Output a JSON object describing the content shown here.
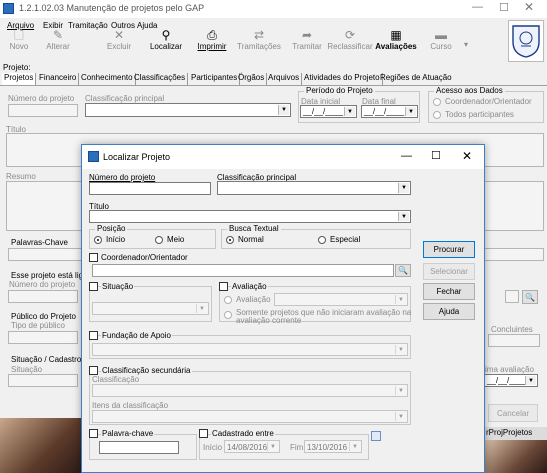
{
  "window": {
    "title": "1.2.1.02.03 Manutenção de projetos pelo GAP",
    "seal_text": "Universidade Federal de Viçosa"
  },
  "menu": [
    "Arquivo",
    "Exibir",
    "Tramitação",
    "Outros",
    "Ajuda"
  ],
  "toolbar": [
    {
      "label": "Novo",
      "icon": "new-document-icon"
    },
    {
      "label": "Alterar",
      "icon": "edit-icon"
    },
    {
      "label": "Excluir",
      "icon": "delete-icon"
    },
    {
      "label": "Localizar",
      "icon": "binoculars-icon"
    },
    {
      "label": "Imprimir",
      "icon": "printer-icon"
    },
    {
      "label": "Tramitações",
      "icon": "tramitation-icon"
    },
    {
      "label": "Tramitar",
      "icon": "send-icon"
    },
    {
      "label": "Reclassificar",
      "icon": "reclassify-icon"
    },
    {
      "label": "Avaliações",
      "icon": "evaluations-icon"
    },
    {
      "label": "Curso",
      "icon": "course-icon"
    }
  ],
  "main": {
    "section_title": "Projeto:",
    "tabs": [
      "Projetos",
      "Financeiro",
      "Conhecimento",
      "Classificações",
      "Participantes",
      "Órgãos",
      "Arquivos",
      "Atividades do Projeto",
      "Regiões de Atuação"
    ],
    "numero_label": "Número do projeto",
    "classificacao_label": "Classificação principal",
    "periodo": {
      "caption": "Período do Projeto",
      "inicial": "Data inicial",
      "final": "Data final",
      "date_mask": "__/__/____"
    },
    "acesso": {
      "caption": "Acesso aos Dados",
      "opt1": "Coordenador/Orientador",
      "opt2": "Todos participantes"
    },
    "titulo_label": "Título",
    "resumo_label": "Resumo",
    "palavras_label": "Palavras-Chave",
    "ligado_label": "Esse projeto está ligado",
    "numero2_label": "Número do projeto",
    "publico_label": "Público do Projeto",
    "tipo_publico_label": "Tipo de público",
    "situacao_cad_label": "Situação / Cadastro",
    "situacao_label": "Situação",
    "concluintes_label": "Concluintes",
    "ultima_aval_label": "ima avaliação",
    "cancel_label": "Cancelar",
    "status_right": "rProjProjetos",
    "date_mask": "__/__/____"
  },
  "dialog": {
    "title": "Localizar Projeto",
    "numero_label": "Número do projeto",
    "classificacao_label": "Classificação principal",
    "titulo_label": "Título",
    "posicao": {
      "caption": "Posição",
      "inicio": "Início",
      "meio": "Meio"
    },
    "busca": {
      "caption": "Busca Textual",
      "normal": "Normal",
      "especial": "Especial"
    },
    "coordenador_label": "Coordenador/Orientador",
    "situacao_label": "Situação",
    "avaliacao": {
      "caption": "Avaliação",
      "opt1": "Avaliação",
      "opt2_line1": "Somente projetos que não iniciaram avaliação na",
      "opt2_line2": "avaliação corrente"
    },
    "fundacao_label": "Fundação de Apoio",
    "class_sec_label": "Classificação secundária",
    "classificacao_sub": "Classificação",
    "itens_label": "Itens da classificação",
    "palavra_label": "Palavra-chave",
    "cadastrado": {
      "caption": "Cadastrado entre",
      "inicio_label": "Início",
      "inicio_value": "14/08/2016",
      "fim_label": "Fim",
      "fim_value": "13/10/2016"
    },
    "buttons": {
      "procurar": "Procurar",
      "selecionar": "Selecionar",
      "fechar": "Fechar",
      "ajuda": "Ajuda"
    }
  }
}
